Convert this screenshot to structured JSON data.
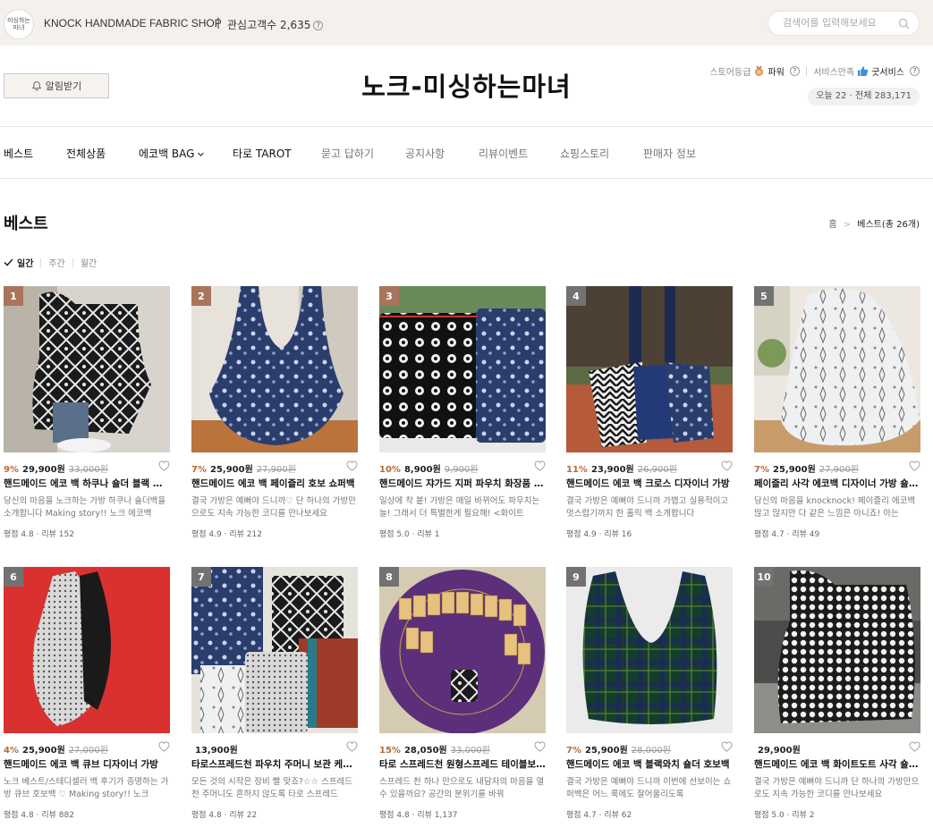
{
  "topbar": {
    "logo_text": "미싱하는마녀",
    "shop_name": "KNOCK HANDMADE FABRIC SHOP",
    "separator": "|",
    "fans_label": "관심고객수 2,635",
    "help_glyph": "?",
    "search_placeholder": "검색어를 입력해보세요"
  },
  "store": {
    "alarm_label": "알림받기",
    "title": "노크-미싱하는마녀",
    "grade_label": "스토어등급",
    "grade_value": "파워",
    "service_label": "서비스만족",
    "service_value": "굿서비스",
    "visitors": "오늘 22 · 전체 283,171"
  },
  "nav": [
    {
      "label": "베스트"
    },
    {
      "label": "전체상품"
    },
    {
      "label": "에코백 BAG"
    },
    {
      "label": "타로 TAROT"
    },
    {
      "label": "묻고 답하기"
    },
    {
      "label": "공지사항"
    },
    {
      "label": "리뷰이벤트"
    },
    {
      "label": "쇼핑스토리"
    },
    {
      "label": "판매자 정보"
    }
  ],
  "section": {
    "heading": "베스트",
    "crumb_home": "홈",
    "crumb_sep": ">",
    "crumb_current": "베스트(총 26개)",
    "periods": [
      "일간",
      "주간",
      "월간"
    ]
  },
  "colors": {
    "rank_top3": "#a9755a",
    "rank_other": "#727272",
    "discount": "#b5693a",
    "topbar_bg": "#f4f1ec"
  },
  "products": [
    {
      "rank": "1",
      "discount": "9%",
      "price": "29,900원",
      "original": "33,000원",
      "name": "핸드메이드 에코 백 하쿠나 숄더 블랙 화이트 가방",
      "desc": "당신의 마음을 노크하는 가방 하쿠나 숄더백을 소개합니다 Making story!! 노크 에코백",
      "stats": "평점 4.8 · 리뷰 152"
    },
    {
      "rank": "2",
      "discount": "7%",
      "price": "25,900원",
      "original": "27,900원",
      "name": "핸드메이드 에코 백 페이즐리 호보 쇼퍼백",
      "desc": "결국 가방은 예뻐야 드니까♡ 단 하나의 가방만으로도 지속 가능한 코디를 만나보세요",
      "stats": "평점 4.9 · 리뷰 212"
    },
    {
      "rank": "3",
      "discount": "10%",
      "price": "8,900원",
      "original": "9,900원",
      "name": "핸드메이드 쟈가드 지퍼 파우치 화장품 파우치",
      "desc": "일상에 착 붙! 가방은 매일 바뀌어도 파우치는 늘! 그래서 더 특별한게 필요해! <화이트",
      "stats": "평점 5.0 · 리뷰 1"
    },
    {
      "rank": "4",
      "discount": "11%",
      "price": "23,900원",
      "original": "26,900원",
      "name": "핸드메이드 에코 백 크로스 디자이너 가방",
      "desc": "결국 가방은 예뻐야 드니까 가볍고 실용적이고 멋스럽기까지 한 홀릭 백 소개합니다",
      "stats": "평점 4.9 · 리뷰 16"
    },
    {
      "rank": "5",
      "discount": "7%",
      "price": "25,900원",
      "original": "27,900원",
      "name": "페이즐리 사각 에코백 디자이너 가방 숄더백",
      "desc": "당신의 마음을 knocknock! 페이즐리 에코백 많고 많지만 다 같은 느낌은 아니죠! 아는",
      "stats": "평점 4.7 · 리뷰 49"
    },
    {
      "rank": "6",
      "discount": "4%",
      "price": "25,900원",
      "original": "27,000원",
      "name": "핸드메이드 에코 백 큐브 디자이너 가방",
      "desc": "노크 베스트/스테디셀러 백 후기가 증명하는 가방 큐브 호보백 ♡ Making story!! 노크",
      "stats": "평점 4.8 · 리뷰 882"
    },
    {
      "rank": "7",
      "discount": "",
      "price": "13,900원",
      "original": "",
      "name": "타로스프레드천 파우치 주머니 보관 케이스",
      "desc": "모든 것의 시작은 장비 빨 맞죠?☆☆ 스프레드 천 주머니도 흔하지 않도록 타로 스프레드",
      "stats": "평점 4.8 · 리뷰 22"
    },
    {
      "rank": "8",
      "discount": "15%",
      "price": "28,050원",
      "original": "33,000원",
      "name": "타로 스프레드천 원형스프레드 테이블보 러그",
      "desc": "스프레드 천 하나 만으로도 내담자의 마음을 열수 있을까요? 공간의 분위기를 바꿔",
      "stats": "평점 4.8 · 리뷰 1,137"
    },
    {
      "rank": "9",
      "discount": "7%",
      "price": "25,900원",
      "original": "28,000원",
      "name": "핸드메이드 에코 백 블랙와치 숄더 호보백",
      "desc": "결국 가방은 예뻐야 드니까 이번에 선보이는 쇼퍼백은 어느 룩에도 잘어울리도록",
      "stats": "평점 4.7 · 리뷰 62"
    },
    {
      "rank": "10",
      "discount": "",
      "price": "29,900원",
      "original": "",
      "name": "핸드메이드 에코 백 화이트도트 사각 숄더백",
      "desc": "결국 가방은 예뻐야 드니까 단 하나의 가방만으로도 지속 가능한 코디를 만나보세요",
      "stats": "평점 5.0 · 리뷰 2"
    }
  ]
}
